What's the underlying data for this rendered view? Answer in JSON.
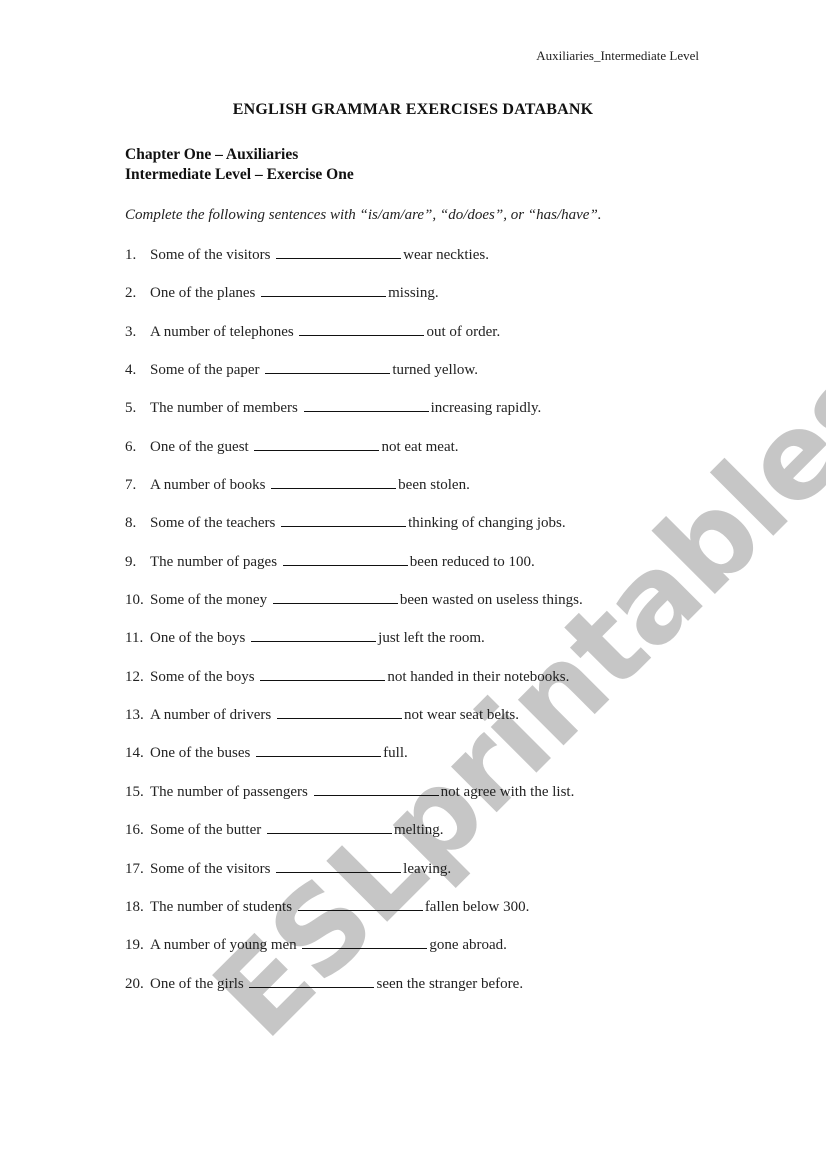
{
  "header_note": "Auxiliaries_Intermediate Level",
  "title": "ENGLISH GRAMMAR EXERCISES DATABANK",
  "chapter": "Chapter One – Auxiliaries",
  "level": "Intermediate Level – Exercise One",
  "instructions": "Complete the following sentences with “is/am/are”, “do/does”, or “has/have”.",
  "watermark": "ESLprintables.com",
  "items": [
    {
      "num": "1.",
      "before": "Some of the visitors",
      "after": "wear neckties."
    },
    {
      "num": "2.",
      "before": "One of the planes",
      "after": "missing."
    },
    {
      "num": "3.",
      "before": "A number of telephones",
      "after": "out of order."
    },
    {
      "num": "4.",
      "before": "Some of the paper",
      "after": "turned yellow."
    },
    {
      "num": "5.",
      "before": "The number of members",
      "after": "increasing rapidly."
    },
    {
      "num": "6.",
      "before": "One of the guest",
      "after": "not eat meat."
    },
    {
      "num": "7.",
      "before": "A number of books",
      "after": "been stolen."
    },
    {
      "num": "8.",
      "before": "Some of the teachers",
      "after": "thinking of changing jobs."
    },
    {
      "num": "9.",
      "before": "The number of pages",
      "after": "been reduced to 100."
    },
    {
      "num": "10.",
      "before": "Some of the money",
      "after": "been wasted on useless things."
    },
    {
      "num": "11.",
      "before": "One of the boys",
      "after": "just left the room."
    },
    {
      "num": "12.",
      "before": "Some of the boys",
      "after": "not handed in their notebooks."
    },
    {
      "num": "13.",
      "before": "A number of drivers",
      "after": "not wear seat belts."
    },
    {
      "num": "14.",
      "before": "One of the buses",
      "after": "full."
    },
    {
      "num": "15.",
      "before": "The number of passengers",
      "after": "not agree with the list."
    },
    {
      "num": "16.",
      "before": "Some of the butter",
      "after": "melting."
    },
    {
      "num": "17.",
      "before": "Some of the visitors",
      "after": "leaving."
    },
    {
      "num": "18.",
      "before": "The number of students",
      "after": "fallen below 300."
    },
    {
      "num": "19.",
      "before": "A number of young men",
      "after": "gone abroad."
    },
    {
      "num": "20.",
      "before": "One of the girls",
      "after": "seen the stranger before."
    }
  ]
}
